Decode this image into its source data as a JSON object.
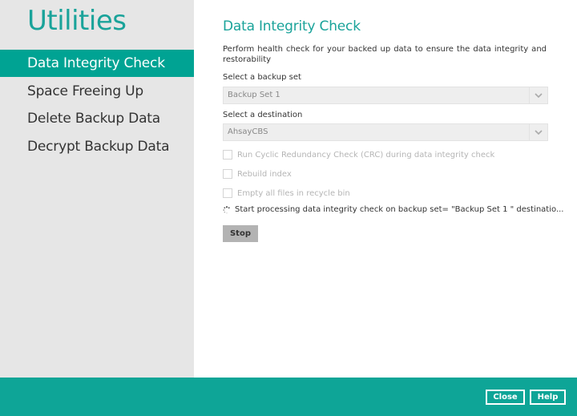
{
  "sidebar": {
    "title": "Utilities",
    "items": [
      {
        "label": "Data Integrity Check",
        "active": true
      },
      {
        "label": "Space Freeing Up",
        "active": false
      },
      {
        "label": "Delete Backup Data",
        "active": false
      },
      {
        "label": "Decrypt Backup Data",
        "active": false
      }
    ]
  },
  "main": {
    "title": "Data Integrity Check",
    "description": "Perform health check for your backed up data to ensure the data integrity and restorability",
    "backup_set": {
      "label": "Select a backup set",
      "value": "Backup Set 1"
    },
    "destination": {
      "label": "Select a destination",
      "value": "AhsayCBS"
    },
    "options": [
      {
        "label": "Run Cyclic Redundancy Check (CRC) during data integrity check",
        "checked": false
      },
      {
        "label": "Rebuild index",
        "checked": false
      },
      {
        "label": "Empty all files in recycle bin",
        "checked": false
      }
    ],
    "status": "Start processing data integrity check on backup set= \"Backup Set 1 \" destinatio...",
    "stop_label": "Stop"
  },
  "footer": {
    "close_label": "Close",
    "help_label": "Help"
  },
  "colors": {
    "accent": "#00a393",
    "title_teal": "#1aa39a",
    "footer": "#0ea597"
  }
}
